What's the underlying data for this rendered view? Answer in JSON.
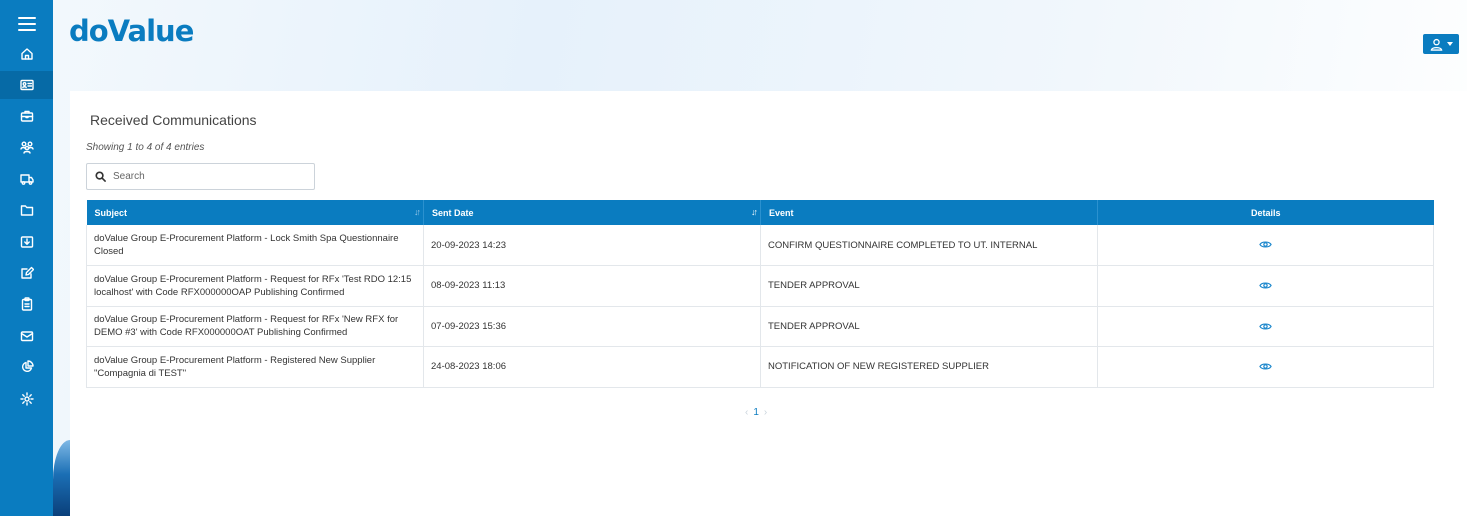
{
  "app": {
    "logo_text": "doValue"
  },
  "sidebar": {
    "items": [
      {
        "icon": "menu-icon"
      },
      {
        "icon": "home-icon"
      },
      {
        "icon": "id-card-icon",
        "active": true
      },
      {
        "icon": "briefcase-icon"
      },
      {
        "icon": "users-icon"
      },
      {
        "icon": "truck-icon"
      },
      {
        "icon": "folder-icon"
      },
      {
        "icon": "download-icon"
      },
      {
        "icon": "edit-icon"
      },
      {
        "icon": "clipboard-icon"
      },
      {
        "icon": "mail-icon"
      },
      {
        "icon": "chart-icon"
      },
      {
        "icon": "gear-icon"
      }
    ]
  },
  "header": {
    "user_icon": "user-icon"
  },
  "page": {
    "title": "Received Communications",
    "showing": "Showing 1 to 4 of 4 entries",
    "search_placeholder": "Search"
  },
  "table": {
    "columns": [
      "Subject",
      "Sent Date",
      "Event",
      "Details"
    ],
    "rows": [
      {
        "subject": "doValue Group E-Procurement Platform - Lock Smith Spa Questionnaire Closed",
        "sent_date": "20-09-2023 14:23",
        "event": "CONFIRM QUESTIONNAIRE COMPLETED TO UT. INTERNAL"
      },
      {
        "subject": "doValue Group E-Procurement Platform - Request for RFx 'Test RDO 12:15 localhost' with Code RFX000000OAP Publishing Confirmed",
        "sent_date": "08-09-2023 11:13",
        "event": "TENDER APPROVAL"
      },
      {
        "subject": "doValue Group E-Procurement Platform - Request for RFx 'New RFX for DEMO #3' with Code RFX000000OAT Publishing Confirmed",
        "sent_date": "07-09-2023 15:36",
        "event": "TENDER APPROVAL"
      },
      {
        "subject": "doValue Group E-Procurement Platform - Registered New Supplier \"Compagnia di TEST\"",
        "sent_date": "24-08-2023 18:06",
        "event": "NOTIFICATION OF NEW REGISTERED SUPPLIER"
      }
    ]
  },
  "pagination": {
    "prev": "‹",
    "current": "1",
    "next": "›"
  },
  "colors": {
    "brand": "#0a7cc0",
    "sidebar": "#0a7cc0",
    "header_row": "#0a7cc0"
  }
}
